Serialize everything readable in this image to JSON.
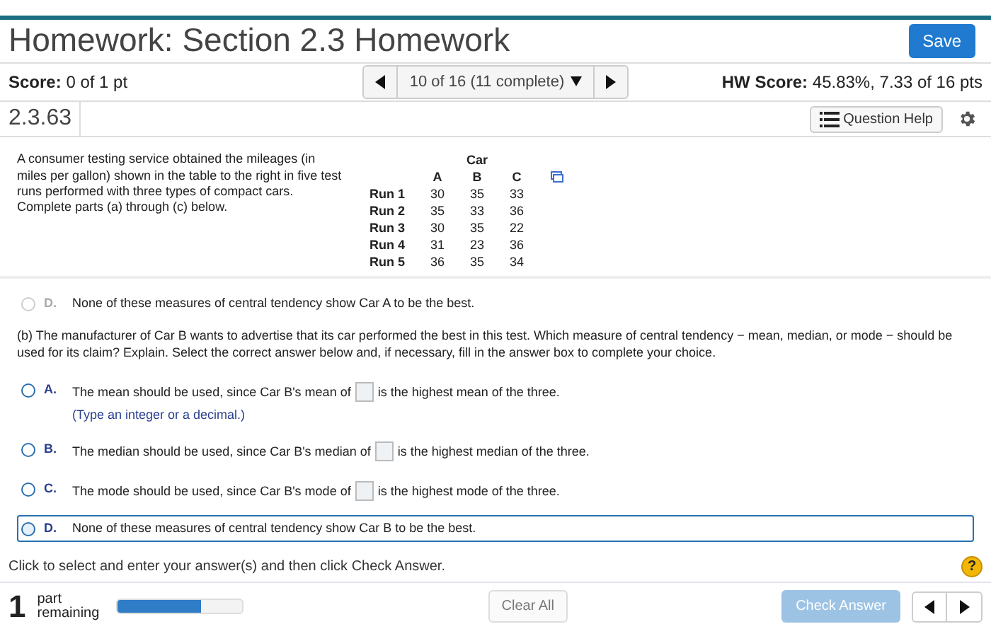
{
  "header": {
    "title": "Homework: Section 2.3 Homework",
    "save_button": "Save"
  },
  "score_bar": {
    "score_label": "Score:",
    "score_value": "0 of 1 pt",
    "question_nav": "10 of 16 (11 complete)",
    "hw_label": "HW Score:",
    "hw_value": "45.83%, 7.33 of 16 pts"
  },
  "question_bar": {
    "id": "2.3.63",
    "help_button": "Question Help"
  },
  "problem": {
    "text": "A consumer testing service obtained the mileages (in miles per gallon) shown in the table to the right in five test runs performed with three types of compact cars. Complete parts (a) through (c) below.",
    "table": {
      "group_header": "Car",
      "columns": [
        "A",
        "B",
        "C"
      ],
      "rows": [
        {
          "label": "Run 1",
          "values": [
            "30",
            "35",
            "33"
          ]
        },
        {
          "label": "Run 2",
          "values": [
            "35",
            "33",
            "36"
          ]
        },
        {
          "label": "Run 3",
          "values": [
            "30",
            "35",
            "22"
          ]
        },
        {
          "label": "Run 4",
          "values": [
            "31",
            "23",
            "36"
          ]
        },
        {
          "label": "Run 5",
          "values": [
            "36",
            "35",
            "34"
          ]
        }
      ]
    }
  },
  "part_a_last": {
    "letter": "D.",
    "text": "None of these measures of central tendency show Car A to be the best.",
    "disabled": true
  },
  "part_b": {
    "prompt": "(b) The manufacturer of Car B wants to advertise that its car performed the best in this test. Which measure of central tendency − mean, median, or mode − should be used for its claim? Explain. Select the correct answer below and, if necessary, fill in the answer box to complete your choice.",
    "options": [
      {
        "letter": "A.",
        "before": "The mean should be used, since Car B's mean of",
        "after": "is the highest mean of the three.",
        "hint": "(Type an integer or a decimal.)",
        "selected": false
      },
      {
        "letter": "B.",
        "before": "The median should be used, since Car B's median of",
        "after": "is the highest median of the three.",
        "selected": false
      },
      {
        "letter": "C.",
        "before": "The mode should be used, since Car B's mode of",
        "after": "is the highest mode of the three.",
        "selected": false
      },
      {
        "letter": "D.",
        "before": "None of these measures of central tendency show Car B to be the best.",
        "selected": true
      }
    ]
  },
  "instruction": "Click to select and enter your answer(s) and then click Check Answer.",
  "help_mark": "?",
  "footer": {
    "count": "1",
    "count_label": "part remaining",
    "level": 0.67,
    "clear_button": "Clear All",
    "check_button": "Check Answer",
    "check_disabled": true
  }
}
